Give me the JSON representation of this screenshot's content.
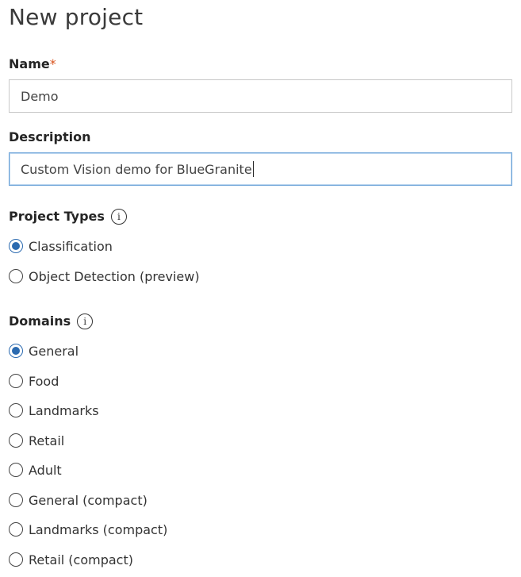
{
  "page": {
    "title": "New project"
  },
  "name_field": {
    "label": "Name",
    "required_mark": "*",
    "value": "Demo"
  },
  "description_field": {
    "label": "Description",
    "value": "Custom Vision demo for BlueGranite"
  },
  "project_types": {
    "label": "Project Types",
    "info_glyph": "i",
    "options": [
      {
        "label": "Classification",
        "checked": true
      },
      {
        "label": "Object Detection (preview)",
        "checked": false
      }
    ]
  },
  "domains": {
    "label": "Domains",
    "info_glyph": "i",
    "options": [
      {
        "label": "General",
        "checked": true
      },
      {
        "label": "Food",
        "checked": false
      },
      {
        "label": "Landmarks",
        "checked": false
      },
      {
        "label": "Retail",
        "checked": false
      },
      {
        "label": "Adult",
        "checked": false
      },
      {
        "label": "General (compact)",
        "checked": false
      },
      {
        "label": "Landmarks (compact)",
        "checked": false
      },
      {
        "label": "Retail (compact)",
        "checked": false
      }
    ]
  },
  "colors": {
    "accent": "#2b6ab0",
    "required": "#d9531e",
    "focus_border": "#6aa2d8"
  }
}
